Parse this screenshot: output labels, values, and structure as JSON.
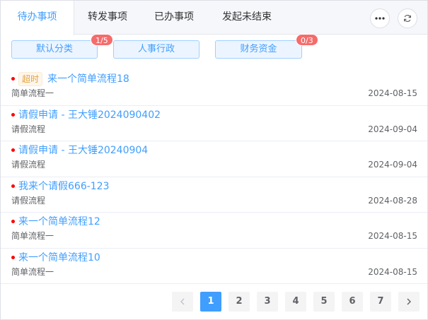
{
  "tabs": [
    {
      "label": "待办事项",
      "active": true
    },
    {
      "label": "转发事项",
      "active": false
    },
    {
      "label": "已办事项",
      "active": false
    },
    {
      "label": "发起未结束",
      "active": false
    }
  ],
  "toolbar": {
    "more_icon": "more-icon",
    "refresh_icon": "refresh-icon"
  },
  "categories": [
    {
      "label": "默认分类",
      "badge": "1/5"
    },
    {
      "label": "人事行政",
      "badge": ""
    },
    {
      "label": "财务资金",
      "badge": "0/3"
    }
  ],
  "items": [
    {
      "tag": "超时",
      "title": "来一个简单流程18",
      "process": "简单流程一",
      "date": "2024-08-15"
    },
    {
      "tag": "",
      "title": "请假申请 - 王大锤2024090402",
      "process": "请假流程",
      "date": "2024-09-04"
    },
    {
      "tag": "",
      "title": "请假申请 - 王大锤20240904",
      "process": "请假流程",
      "date": "2024-09-04"
    },
    {
      "tag": "",
      "title": "我来个请假666-123",
      "process": "请假流程",
      "date": "2024-08-28"
    },
    {
      "tag": "",
      "title": "来一个简单流程12",
      "process": "简单流程一",
      "date": "2024-08-15"
    },
    {
      "tag": "",
      "title": "来一个简单流程10",
      "process": "简单流程一",
      "date": "2024-08-15"
    }
  ],
  "pagination": {
    "pages": [
      "1",
      "2",
      "3",
      "4",
      "5",
      "6",
      "7"
    ],
    "current": "1"
  },
  "colors": {
    "accent": "#409eff",
    "badge": "#f56c6c",
    "dot": "#ff0000",
    "tag_text": "#e6a23c"
  }
}
